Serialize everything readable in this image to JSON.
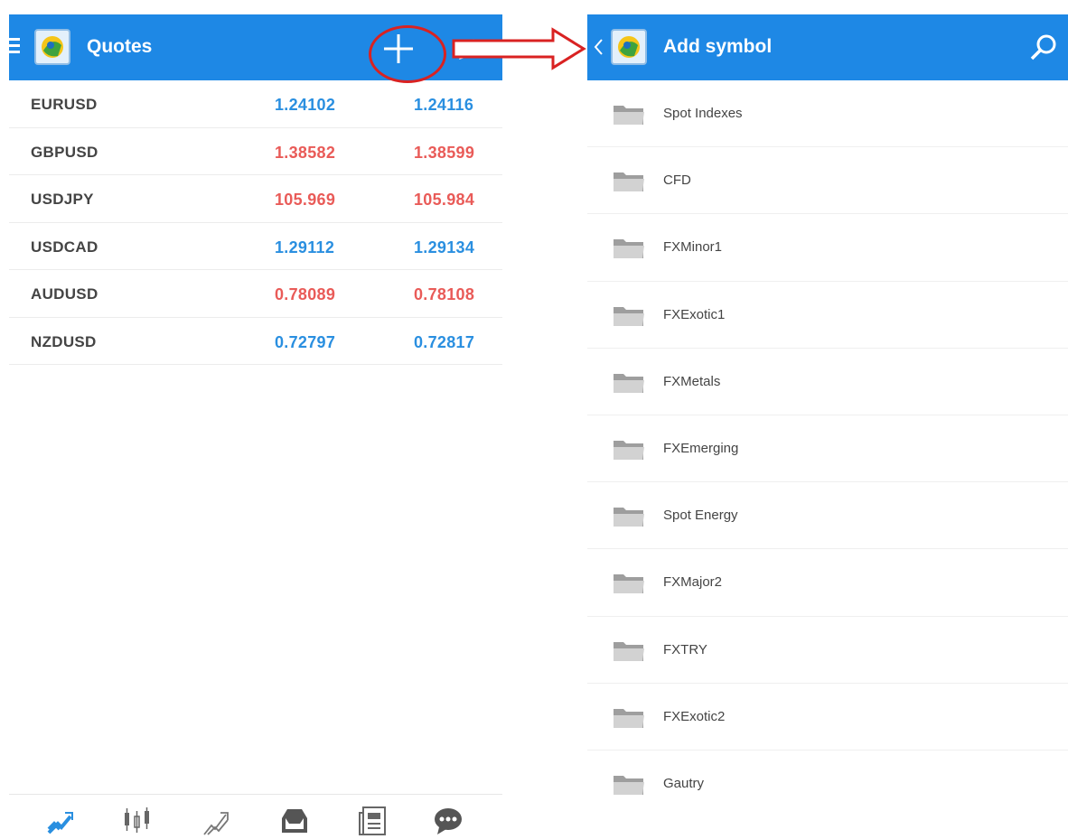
{
  "quotes_screen": {
    "title": "Quotes",
    "icons": {
      "menu": "hamburger-icon",
      "logo": "metatrader-logo",
      "add": "plus-icon",
      "edit": "pencil-icon"
    },
    "rows": [
      {
        "symbol": "EURUSD",
        "bid": "1.24102",
        "ask": "1.24116",
        "direction": "up"
      },
      {
        "symbol": "GBPUSD",
        "bid": "1.38582",
        "ask": "1.38599",
        "direction": "down"
      },
      {
        "symbol": "USDJPY",
        "bid": "105.969",
        "ask": "105.984",
        "direction": "down"
      },
      {
        "symbol": "USDCAD",
        "bid": "1.29112",
        "ask": "1.29134",
        "direction": "up"
      },
      {
        "symbol": "AUDUSD",
        "bid": "0.78089",
        "ask": "0.78108",
        "direction": "down"
      },
      {
        "symbol": "NZDUSD",
        "bid": "0.72797",
        "ask": "0.72817",
        "direction": "up"
      }
    ],
    "bottom_nav": [
      "quotes-icon",
      "chart-icon",
      "trade-icon",
      "history-icon",
      "news-icon",
      "chat-icon"
    ]
  },
  "add_symbol_screen": {
    "title": "Add symbol",
    "icons": {
      "back": "chevron-left-icon",
      "search": "search-icon"
    },
    "folders": [
      "Spot Indexes",
      "CFD",
      "FXMinor1",
      "FXExotic1",
      "FXMetals",
      "FXEmerging",
      "Spot Energy",
      "FXMajor2",
      "FXTRY",
      "FXExotic2",
      "Gautry"
    ]
  },
  "colors": {
    "toolbar": "#1e88e5",
    "price_up": "#2a8fe0",
    "price_down": "#e95b58",
    "annotation": "#d92222"
  }
}
